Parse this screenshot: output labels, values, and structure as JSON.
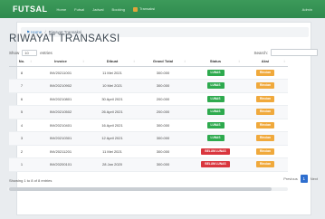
{
  "navbar": {
    "brand": "FUTSAL",
    "links": [
      "Home",
      "Futsal",
      "Jadwal",
      "Booking"
    ],
    "notification_label": "Transaksi",
    "account_label": "Admin"
  },
  "breadcrumb": {
    "home": "Home",
    "current": "Riwayat Transaksi"
  },
  "page_title": "RIWAYAT TRANSAKSI",
  "table_controls": {
    "show_prefix": "Show",
    "show_value": "10",
    "show_suffix": "entries",
    "search_label": "Search:",
    "search_value": ""
  },
  "table": {
    "columns": [
      "No.",
      "Invoice",
      "Dibuat",
      "Grand Total",
      "Status",
      "Aksi"
    ],
    "rows": [
      {
        "no": "8",
        "invoice": "INV20211001",
        "date": "11 Mei 2021",
        "total": "300.000",
        "status": "LUNAS",
        "status_type": "lunas",
        "action": "Rincian"
      },
      {
        "no": "7",
        "invoice": "INV20210902",
        "date": "10 Mei 2021",
        "total": "300.000",
        "status": "LUNAS",
        "status_type": "lunas",
        "action": "Rincian"
      },
      {
        "no": "6",
        "invoice": "INV20210801",
        "date": "30 April 2021",
        "total": "200.000",
        "status": "LUNAS",
        "status_type": "lunas",
        "action": "Rincian"
      },
      {
        "no": "5",
        "invoice": "INV20210502",
        "date": "26 April 2021",
        "total": "200.000",
        "status": "LUNAS",
        "status_type": "lunas",
        "action": "Rincian"
      },
      {
        "no": "4",
        "invoice": "INV20210401",
        "date": "16 April 2021",
        "total": "300.000",
        "status": "LUNAS",
        "status_type": "lunas",
        "action": "Rincian"
      },
      {
        "no": "3",
        "invoice": "INV20210301",
        "date": "12 April 2021",
        "total": "300.000",
        "status": "LUNAS",
        "status_type": "lunas",
        "action": "Rincian"
      },
      {
        "no": "2",
        "invoice": "INV20211201",
        "date": "11 Mei 2021",
        "total": "300.000",
        "status": "BELUM LUNAS",
        "status_type": "belum",
        "action": "Rincian"
      },
      {
        "no": "1",
        "invoice": "INV20200101",
        "date": "28 Jan 2020",
        "total": "300.000",
        "status": "BELUM LUNAS",
        "status_type": "belum",
        "action": "Rincian"
      }
    ]
  },
  "footer": {
    "info": "Showing 1 to 8 of 8 entries",
    "prev": "Previous",
    "page": "1",
    "next": "Next"
  },
  "colors": {
    "navbar": "#2f8a4e",
    "lunas": "#2eaa4e",
    "belum_lunas": "#d9363e",
    "action": "#f0a93c",
    "pager_active": "#2f6fcf"
  }
}
